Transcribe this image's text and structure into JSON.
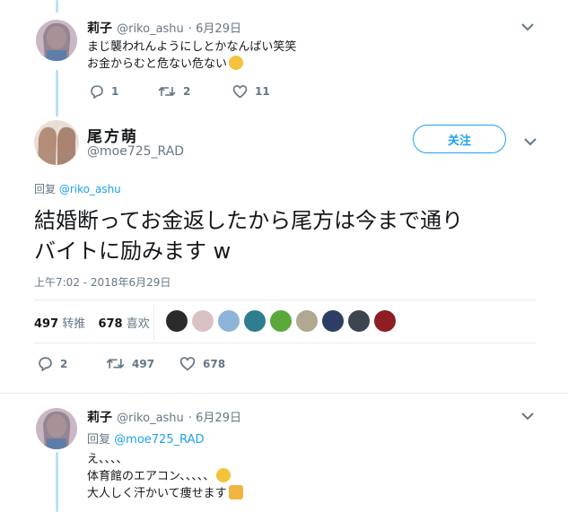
{
  "tweet1": {
    "name": "莉子",
    "handle": "@riko_ashu",
    "date": "· 6月29日",
    "line1": "まじ襲われんようにしとかなんばい笑笑",
    "line2": "お金からむと危ない危ない",
    "emoji": "grimacing-face-emoji",
    "replies": "1",
    "retweets": "2",
    "likes": "11"
  },
  "main_tweet": {
    "name": "尾方萌",
    "handle": "@moe725_RAD",
    "follow_label": "关注",
    "reply_to_label": "回复",
    "reply_to_handle": "@riko_ashu",
    "text_line1": "結婚断ってお金返したから尾方は今まで通り",
    "text_line2": "バイトに励みます w",
    "timestamp": "上午7:02 - 2018年6月29日",
    "retweet_count": "497",
    "retweet_label": "转推",
    "like_count": "678",
    "like_label": "喜欢",
    "replies": "2",
    "retweets": "497",
    "likes": "678",
    "engagers": [
      "#2b2b2b",
      "#d9c2c6",
      "#8fb4d9",
      "#2f7e8f",
      "#5aa83a",
      "#b0a890",
      "#2c3e66",
      "#3d4650",
      "#8e1d24"
    ]
  },
  "tweet3": {
    "name": "莉子",
    "handle": "@riko_ashu",
    "date": "· 6月29日",
    "reply_to_label": "回复",
    "reply_to_handle": "@moe725_RAD",
    "line1": "え、、、、",
    "line2": "体育館のエアコン、、、、、",
    "line3": "大人しく汗かいて痩せます",
    "emoji2": "sad-sweat-face-emoji",
    "emoji3": "people-emoji"
  },
  "colors": {
    "accent": "#1da1f2",
    "muted": "#657786",
    "thread": "#b9e1f7"
  }
}
